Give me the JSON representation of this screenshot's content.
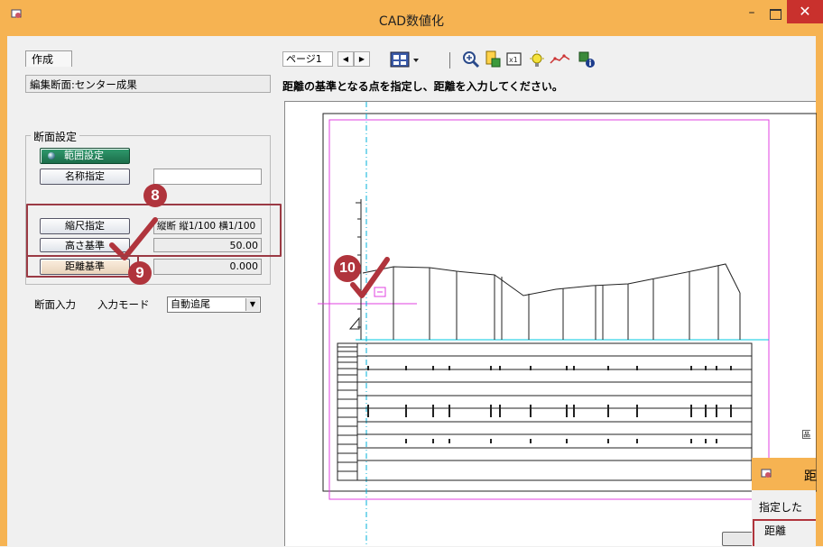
{
  "window": {
    "title": "CAD数値化",
    "minimize": "–",
    "close": "✕"
  },
  "left_panel": {
    "tab_label": "作成",
    "section_name": "編集断面:センター成果",
    "group_title": "断面設定",
    "range_button": "範囲設定",
    "name_button": "名称指定",
    "name_value": "",
    "scale_button": "縮尺指定",
    "scale_value": "縦断 縦1/100 横1/100",
    "height_button": "高さ基準",
    "height_value": "50.00",
    "distance_button": "距離基準",
    "distance_value": "0.000",
    "input_label": "断面入力",
    "mode_label": "入力モード",
    "mode_value": "自動追尾"
  },
  "toolbar": {
    "page_label": "ページ1",
    "prev": "◀",
    "next": "▶",
    "icons": [
      "layout-icon",
      "zoom-icon",
      "page-fit-icon",
      "zoom-window-icon",
      "light-icon",
      "line-icon",
      "info-icon"
    ]
  },
  "instruction": "距離の基準となる点を指定し、距離を入力してください。",
  "callouts": {
    "step8": "8",
    "step9": "9",
    "step10": "10"
  },
  "dialog": {
    "title_fragment": "距",
    "text_fragment": "指定した",
    "field_label": "距離",
    "side_marker": "區"
  },
  "colors": {
    "titlebar": "#f6b352",
    "close": "#c9312d",
    "callout": "#b0343c",
    "active_button": "#2f9a6d",
    "guide_magenta": "#e040e0",
    "guide_cyan": "#00c8e0"
  }
}
